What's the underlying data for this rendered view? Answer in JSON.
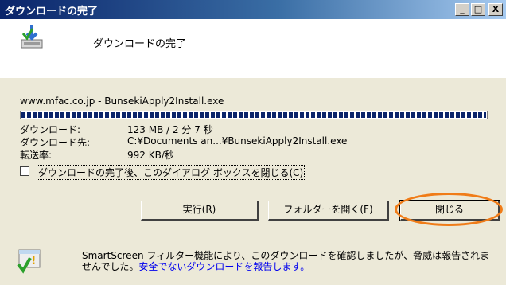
{
  "window": {
    "title": "ダウンロードの完了"
  },
  "titlebar_buttons": {
    "minimize": "_",
    "maximize": "□",
    "close": "X"
  },
  "header": {
    "title": "ダウンロードの完了"
  },
  "download": {
    "source": "www.mfac.co.jp - BunsekiApply2Install.exe",
    "progress_percent": 100,
    "rows": [
      {
        "label": "ダウンロード:",
        "value": "123 MB / 2 分 7 秒"
      },
      {
        "label": "ダウンロード先:",
        "value": "C:¥Documents an...¥BunsekiApply2Install.exe"
      },
      {
        "label": "転送率:",
        "value": "992 KB/秒"
      }
    ]
  },
  "checkbox": {
    "label": "ダウンロードの完了後、このダイアログ ボックスを閉じる(C)",
    "checked": false
  },
  "buttons": {
    "run": "実行(R)",
    "open_folder": "フォルダーを開く(F)",
    "close": "閉じる"
  },
  "footer": {
    "text": "SmartScreen フィルター機能により、このダウンロードを確認しましたが、脅威は報告されませんでした。",
    "link": "安全でないダウンロードを報告します。"
  },
  "colors": {
    "accent_ring": "#f07c18",
    "titlebar": "#0a246a",
    "link": "#0000ee"
  }
}
